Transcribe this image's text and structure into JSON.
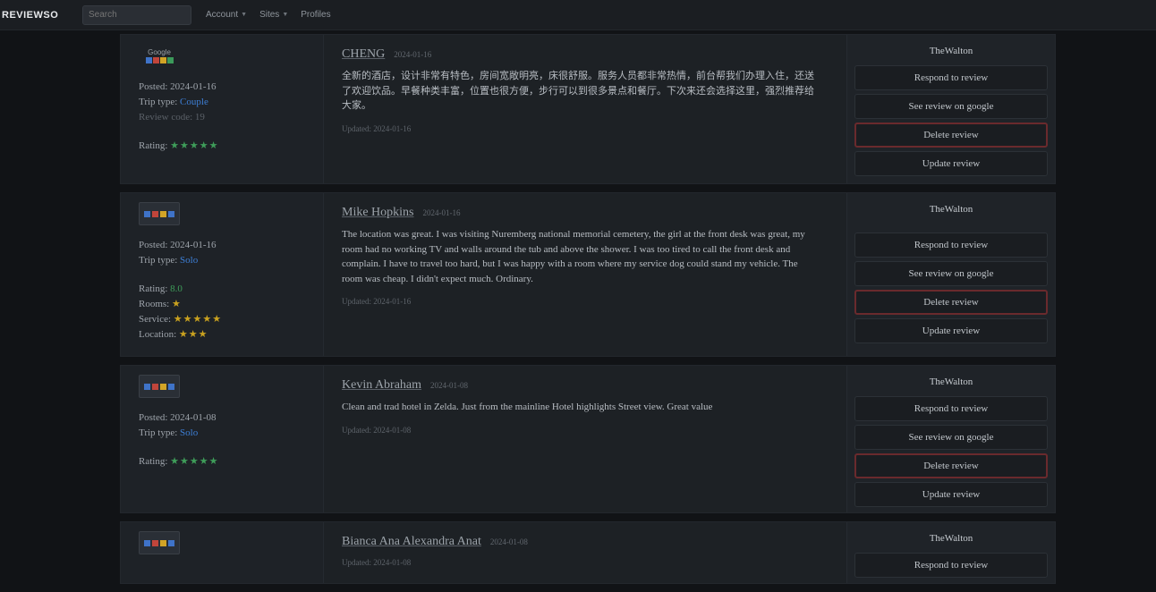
{
  "topbar": {
    "brand": "REVIEWSO",
    "search_placeholder": "Search",
    "nav": [
      {
        "label": "Account",
        "caret": true
      },
      {
        "label": "Sites",
        "caret": true
      },
      {
        "label": "Profiles",
        "caret": false
      }
    ]
  },
  "reviews": [
    {
      "logo": "google-logo",
      "logo_label": "Google",
      "posted_label": "Posted:",
      "posted": "2024-01-16",
      "trip_label": "Trip type:",
      "trip": "Couple",
      "extra": "Review code: 19",
      "rating_label": "Rating:",
      "rating_stars": "★★★★★",
      "subratings": [],
      "author": "CHENG",
      "date": "2024-01-16",
      "text": "全新的酒店，设计非常有特色，房间宽敞明亮，床很舒服。服务人员都非常热情，前台帮我们办理入住，还送了欢迎饮品。早餐种类丰富，位置也很方便，步行可以到很多景点和餐厅。下次来还会选择这里，强烈推荐给大家。",
      "updated": "Updated: 2024-01-16",
      "platform": "TheWalton",
      "actions": {
        "respond": "Respond to review",
        "see": "See review on google",
        "delete": "Delete review",
        "update": "Update review"
      }
    },
    {
      "logo": "booking-logo",
      "logo_label": "Booking",
      "posted_label": "Posted:",
      "posted": "2024-01-16",
      "trip_label": "Trip type:",
      "trip": "Solo",
      "extra": "",
      "rating_label": "Rating:",
      "rating_stars": "8.0",
      "subratings": [
        {
          "label": "Rooms:",
          "stars": "★"
        },
        {
          "label": "Service:",
          "stars": "★★★★★"
        },
        {
          "label": "Location:",
          "stars": "★★★"
        }
      ],
      "author": "Mike Hopkins",
      "date": "2024-01-16",
      "text": "The location was great. I was visiting Nuremberg national memorial cemetery, the girl at the front desk was great, my room had no working TV and walls around the tub and above the shower. I was too tired to call the front desk and complain. I have to travel too hard, but I was happy with a room where my service dog could stand my vehicle. The room was cheap. I didn't expect much. Ordinary.",
      "updated": "Updated: 2024-01-16",
      "platform": "TheWalton",
      "actions": {
        "respond": "Respond to review",
        "see": "See review on google",
        "delete": "Delete review",
        "update": "Update review"
      }
    },
    {
      "logo": "booking-logo",
      "logo_label": "Booking",
      "posted_label": "Posted:",
      "posted": "2024-01-08",
      "trip_label": "Trip type:",
      "trip": "Solo",
      "extra": "",
      "rating_label": "Rating:",
      "rating_stars": "★★★★★",
      "subratings": [],
      "author": "Kevin Abraham",
      "date": "2024-01-08",
      "text": "Clean and trad hotel in Zelda. Just from the mainline Hotel highlights Street view. Great value",
      "updated": "Updated: 2024-01-08",
      "platform": "TheWalton",
      "actions": {
        "respond": "Respond to review",
        "see": "See review on google",
        "delete": "Delete review",
        "update": "Update review"
      }
    },
    {
      "logo": "booking-logo",
      "logo_label": "Booking",
      "posted_label": "",
      "posted": "",
      "trip_label": "",
      "trip": "",
      "extra": "",
      "rating_label": "",
      "rating_stars": "",
      "subratings": [],
      "author": "Bianca Ana Alexandra Anat",
      "date": "2024-01-08",
      "text": "",
      "updated": "Updated: 2024-01-08",
      "platform": "TheWalton",
      "actions": {
        "respond": "Respond to review",
        "see": "",
        "delete": "",
        "update": ""
      }
    }
  ]
}
